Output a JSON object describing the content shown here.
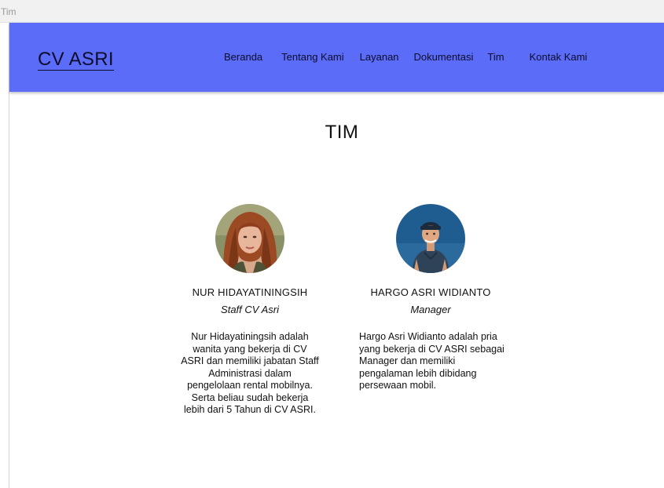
{
  "window": {
    "title": "Tim"
  },
  "navbar": {
    "brand": "CV ASRI",
    "links": [
      "Beranda",
      "Tentang Kami",
      "Layanan",
      "Dokumentasi",
      "Tim",
      "Kontak Kami"
    ],
    "background_color": "#5b6cf8"
  },
  "main": {
    "title": "TIM",
    "members": [
      {
        "name": "NUR HIDAYATININGSIH",
        "role": "Staff CV Asri",
        "bio": "Nur Hidayatiningsih adalah wanita yang bekerja di CV ASRI dan memiliki jabatan Staff Administrasi dalam pengelolaan rental mobilnya. Serta beliau sudah bekerja lebih dari 5 Tahun di CV ASRI.",
        "photo": "woman-portrait"
      },
      {
        "name": "HARGO ASRI WIDIANTO",
        "role": "Manager",
        "bio": "Hargo Asri Widianto adalah pria yang bekerja di CV ASRI sebagai Manager dan memiliki pengalaman lebih dibidang persewaan mobil.",
        "photo": "man-portrait"
      }
    ]
  }
}
